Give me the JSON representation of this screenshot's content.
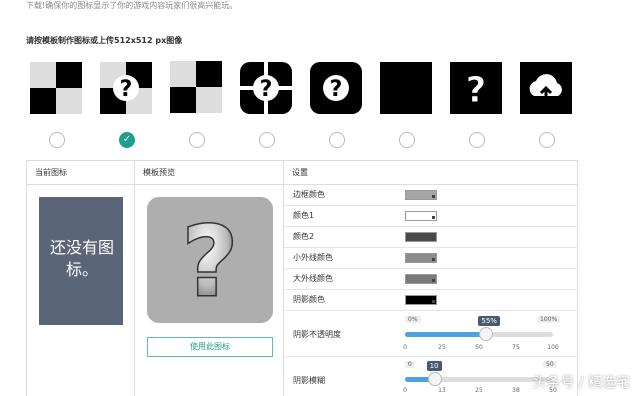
{
  "top_note": "下载!确保你的图标显示了你的游戏内容玩家们很高兴能玩。",
  "section_title": "请按模板制作图标或上传512x512 px图像",
  "templates": [
    {
      "icon": "checker-quad-icon",
      "selected": false
    },
    {
      "icon": "checker-question-icon",
      "selected": true
    },
    {
      "icon": "checker-tall-icon",
      "selected": false
    },
    {
      "icon": "cross-question-icon",
      "selected": false
    },
    {
      "icon": "rounded-question-icon",
      "selected": false
    },
    {
      "icon": "black-square-icon",
      "selected": false
    },
    {
      "icon": "square-question-icon",
      "selected": false
    },
    {
      "icon": "cloud-upload-icon",
      "selected": false
    }
  ],
  "columns": {
    "current": "当前图标",
    "preview": "模板预览",
    "settings": "设置"
  },
  "current_icon_text": "还没有图标。",
  "use_button": "使用此图标",
  "settings": [
    {
      "label": "边框颜色",
      "color": "#a6a6a6"
    },
    {
      "label": "颜色1",
      "color": "#ffffff"
    },
    {
      "label": "颜色2",
      "color": "#4a4a4a"
    },
    {
      "label": "小外线颜色",
      "color": "#8c8c8c"
    },
    {
      "label": "大外线颜色",
      "color": "#7a7a7a"
    },
    {
      "label": "阴影颜色",
      "color": "#000000"
    }
  ],
  "shadow_opacity": {
    "label": "阴影不透明度",
    "min_label": "0%",
    "max_label": "100%",
    "value_label": "55%",
    "value": 55,
    "ticks": [
      "0",
      "25",
      "50",
      "75",
      "100"
    ]
  },
  "shadow_blur": {
    "label": "阴影模糊",
    "min_label": "0",
    "max_label": "50",
    "value_label": "10",
    "value": 10,
    "ticks": [
      "0",
      "13",
      "25",
      "38",
      "50"
    ]
  },
  "watermark": "头条号 / 精选宅"
}
